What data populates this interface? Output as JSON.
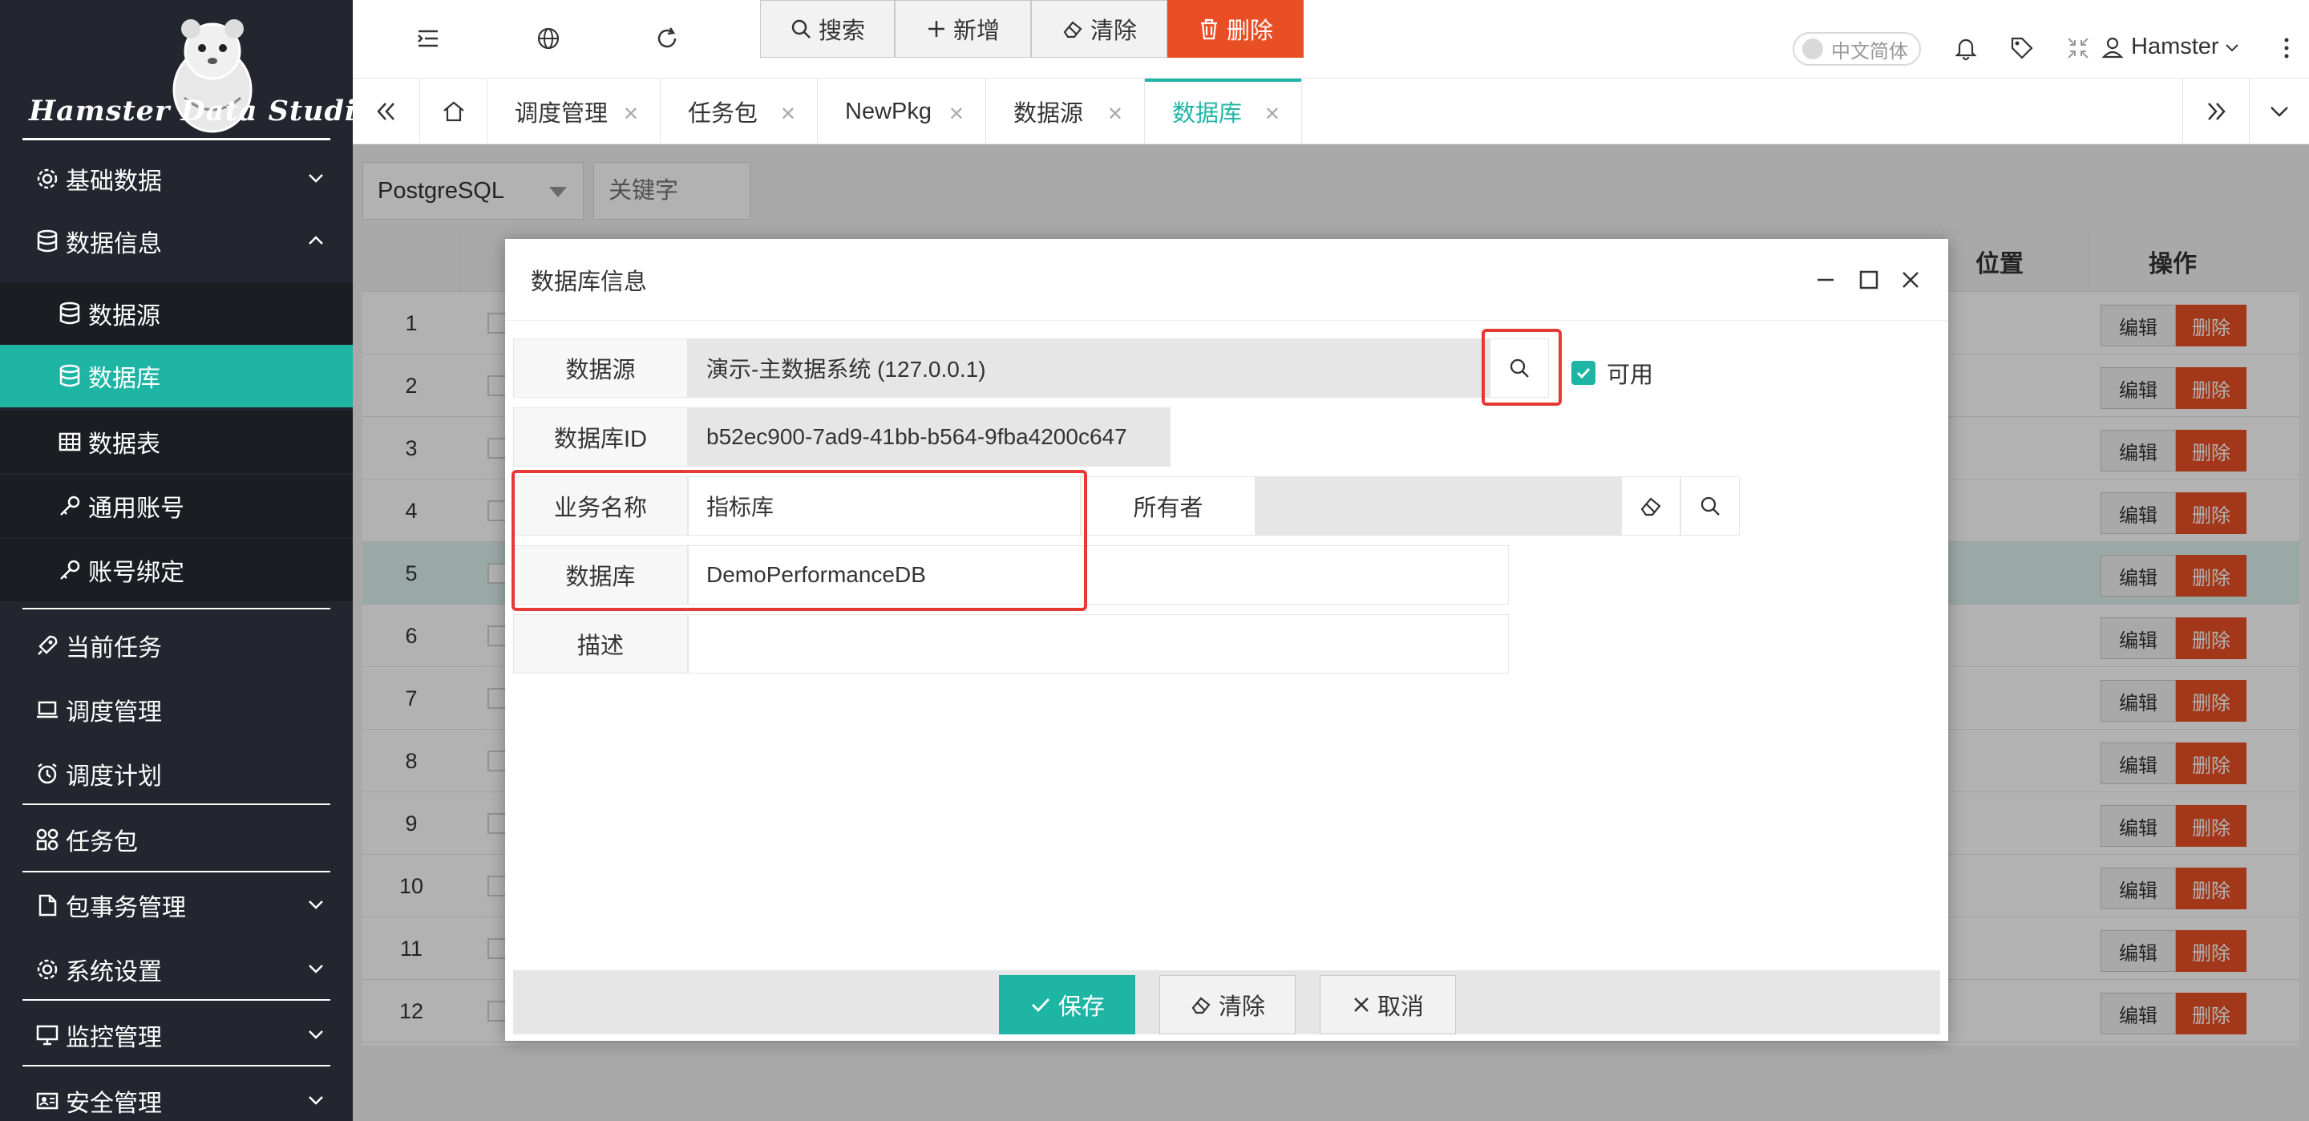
{
  "app": {
    "logo_text": "Hamster Data Studio"
  },
  "sidebar": {
    "items": [
      {
        "label": "基础数据"
      },
      {
        "label": "数据信息"
      },
      {
        "label": "数据源"
      },
      {
        "label": "数据库"
      },
      {
        "label": "数据表"
      },
      {
        "label": "通用账号"
      },
      {
        "label": "账号绑定"
      },
      {
        "label": "当前任务"
      },
      {
        "label": "调度管理"
      },
      {
        "label": "调度计划"
      },
      {
        "label": "任务包"
      },
      {
        "label": "包事务管理"
      },
      {
        "label": "系统设置"
      },
      {
        "label": "监控管理"
      },
      {
        "label": "安全管理"
      }
    ]
  },
  "header": {
    "language": "中文简体",
    "user": "Hamster"
  },
  "tabs": [
    {
      "label": "调度管理"
    },
    {
      "label": "任务包"
    },
    {
      "label": "NewPkg"
    },
    {
      "label": "数据源"
    },
    {
      "label": "数据库"
    }
  ],
  "toolbar": {
    "db_type": "PostgreSQL",
    "keyword_placeholder": "关键字",
    "search_label": "搜索",
    "add_label": "新增",
    "clear_label": "清除",
    "delete_label": "删除"
  },
  "table": {
    "col_position": "位置",
    "col_operation": "操作",
    "edit_label": "编辑",
    "delete_label": "删除",
    "rows": [
      "1",
      "2",
      "3",
      "4",
      "5",
      "6",
      "7",
      "8",
      "9",
      "10",
      "11",
      "12"
    ]
  },
  "modal": {
    "title": "数据库信息",
    "datasource_label": "数据源",
    "datasource_value": "演示-主数据系统 (127.0.0.1)",
    "enabled_label": "可用",
    "dbid_label": "数据库ID",
    "dbid_value": "b52ec900-7ad9-41bb-b564-9fba4200c647",
    "bizname_label": "业务名称",
    "bizname_value": "指标库",
    "owner_label": "所有者",
    "owner_value": "",
    "database_label": "数据库",
    "database_value": "DemoPerformanceDB",
    "desc_label": "描述",
    "desc_value": "",
    "save_label": "保存",
    "clear_label": "清除",
    "cancel_label": "取消"
  },
  "colors": {
    "accent": "#1fb5a5",
    "danger": "#e94f25",
    "sidebar_bg": "#23262e",
    "highlight_box": "#e53935"
  }
}
